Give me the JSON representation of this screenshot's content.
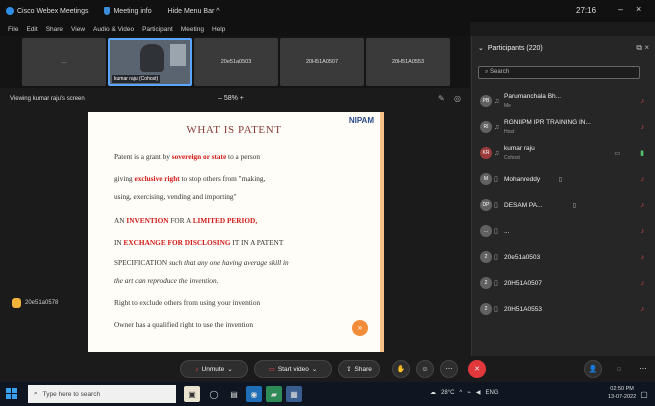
{
  "titlebar": {
    "app_name": "Cisco Webex Meetings",
    "meeting_info": "Meeting info",
    "hide_menu": "Hide Menu Bar ^",
    "time": "27:16",
    "minimize": "–",
    "close": "×"
  },
  "menu": [
    "File",
    "Edit",
    "Share",
    "View",
    "Audio & Video",
    "Participant",
    "Meeting",
    "Help"
  ],
  "thumbnails": [
    {
      "label": "..."
    },
    {
      "label": "kumar raju (Cohost)"
    },
    {
      "label": "20e51a0503"
    },
    {
      "label": "20H51A0507"
    },
    {
      "label": "20H51A0553"
    }
  ],
  "viewing": {
    "label": "Viewing kumar raju's screen",
    "zoom": "– 58% +"
  },
  "slide": {
    "logo": "NIPAM",
    "title": "WHAT IS PATENT",
    "l1a": "Patent is a grant by ",
    "l1b": "sovereign or state",
    "l1c": " to a person",
    "l2a": "giving ",
    "l2b": "exclusive right",
    "l2c": " to stop others from \"making,",
    "l3": "using, exercising, vending and importing\"",
    "l4a": "AN ",
    "l4b": "INVENTION",
    "l4c": " FOR A ",
    "l4d": "LIMITED PERIOD,",
    "l5a": "IN ",
    "l5b": "EXCHANGE FOR DISCLOSING",
    "l5c": " IT IN A PATENT",
    "l6a": "SPECIFICATION ",
    "l6b": "such that any one having average skill in",
    "l7": "the art can reproduce the invention.",
    "l8": "Right to exclude others from using your invention",
    "l9": "Owner has a qualified right to use the invention",
    "dot": "»"
  },
  "presenter_tile": {
    "label": "20e51a0578"
  },
  "participants": {
    "header": "Participants (220)",
    "search_placeholder": "Search",
    "rows": [
      {
        "initials": "PB",
        "name": "Parumanchala Bh...",
        "role": "Me"
      },
      {
        "initials": "RI",
        "name": "RGNIIPM IPR TRAINING IN...",
        "role": "Host"
      },
      {
        "initials": "KR",
        "name": "kumar raju",
        "role": "Cohost"
      },
      {
        "initials": "M",
        "name": "Mohanreddy",
        "role": ""
      },
      {
        "initials": "DP",
        "name": "DESAM PA...",
        "role": ""
      },
      {
        "initials": "…",
        "name": "...",
        "role": ""
      },
      {
        "initials": "2",
        "name": "20e51a0503",
        "role": ""
      },
      {
        "initials": "2",
        "name": "20H51A0507",
        "role": ""
      },
      {
        "initials": "2",
        "name": "20H51A0553",
        "role": ""
      }
    ]
  },
  "controls": {
    "unmute": "Unmute",
    "start_video": "Start video",
    "share": "Share"
  },
  "taskbar": {
    "search_placeholder": "Type here to search",
    "tray_text": "28°C",
    "lang": "ENG",
    "clock_time": "02:50 PM",
    "clock_date": "13-07-2022"
  }
}
